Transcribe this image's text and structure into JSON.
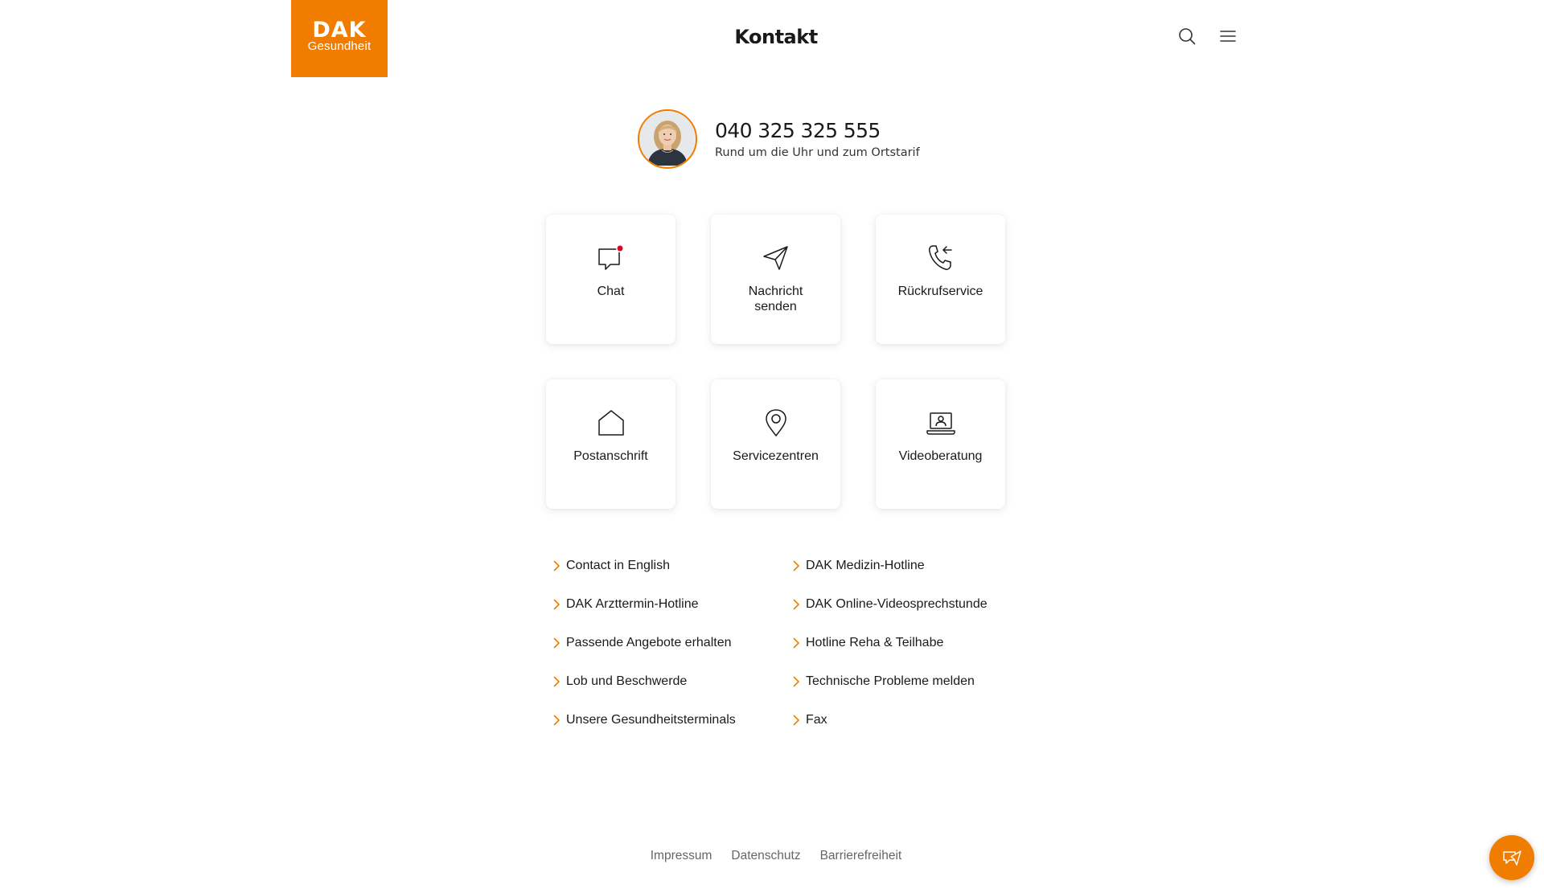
{
  "header": {
    "logo_main": "DAK",
    "logo_sub": "Gesundheit",
    "title": "Kontakt"
  },
  "phone": {
    "number": "040 325 325 555",
    "subtitle": "Rund um die Uhr und zum Ortstarif"
  },
  "tiles": [
    {
      "label": "Chat",
      "icon": "chat-bubble-icon"
    },
    {
      "label": "Nachricht senden",
      "icon": "paper-plane-icon"
    },
    {
      "label": "Rückrufservice",
      "icon": "phone-callback-icon"
    },
    {
      "label": "Postanschrift",
      "icon": "house-icon"
    },
    {
      "label": "Servicezentren",
      "icon": "location-pin-icon"
    },
    {
      "label": "Videoberatung",
      "icon": "laptop-user-icon"
    }
  ],
  "links": [
    "Contact in English",
    "DAK Medizin-Hotline",
    "DAK Arzttermin-Hotline",
    "DAK Online-Videosprechstunde",
    "Passende Angebote erhalten",
    "Hotline Reha & Teilhabe",
    "Lob und Beschwerde",
    "Technische Probleme melden",
    "Unsere Gesundheitsterminals",
    "Fax"
  ],
  "footer": {
    "impressum": "Impressum",
    "datenschutz": "Datenschutz",
    "barrierefreiheit": "Barrierefreiheit"
  },
  "colors": {
    "brand": "#f07d00",
    "notification": "#e2001a"
  }
}
